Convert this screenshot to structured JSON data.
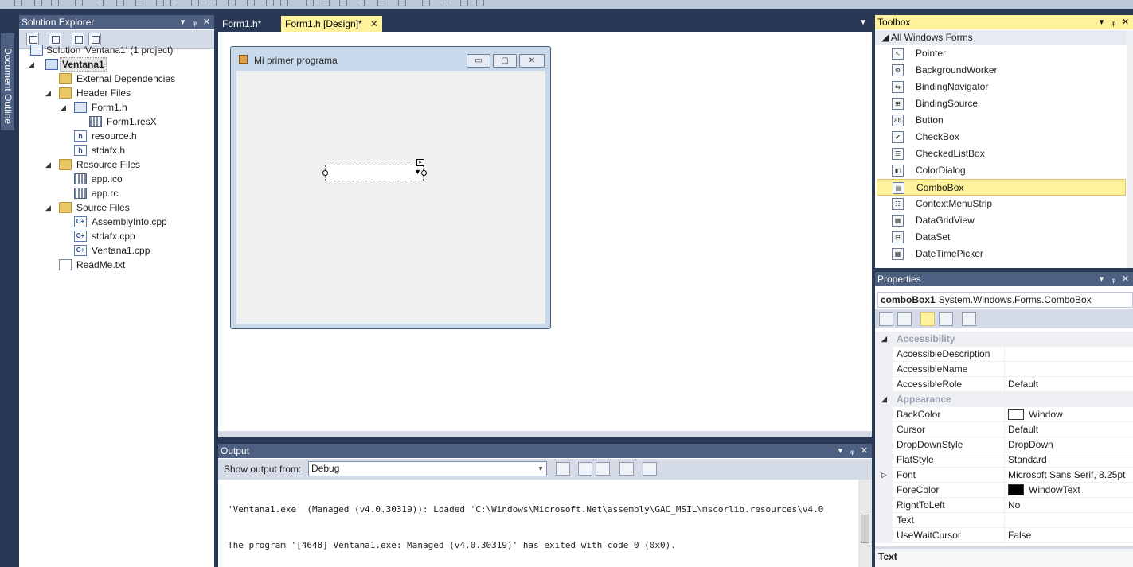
{
  "doc_outline": {
    "label": "Document Outline"
  },
  "solution_explorer": {
    "title": "Solution Explorer",
    "header_buttons": [
      "▾",
      "ᵩ",
      "✕"
    ],
    "tree": [
      {
        "label": "Solution 'Ventana1' (1 project)",
        "icon": "solution-icon",
        "level": 0,
        "arrow": ""
      },
      {
        "label": "Ventana1",
        "icon": "project-icon",
        "level": 0,
        "arrow": "◢",
        "selected": true
      },
      {
        "label": "External Dependencies",
        "icon": "folder-icon",
        "level": 1,
        "arrow": ""
      },
      {
        "label": "Header Files",
        "icon": "folder-icon",
        "level": 1,
        "arrow": "◢"
      },
      {
        "label": "Form1.h",
        "icon": "form-file-icon",
        "level": 2,
        "arrow": "◢"
      },
      {
        "label": "Form1.resX",
        "icon": "resx-file-icon",
        "level": 3,
        "arrow": ""
      },
      {
        "label": "resource.h",
        "icon": "header-file-icon",
        "level": 2,
        "arrow": ""
      },
      {
        "label": "stdafx.h",
        "icon": "header-file-icon",
        "level": 2,
        "arrow": ""
      },
      {
        "label": "Resource Files",
        "icon": "folder-icon",
        "level": 1,
        "arrow": "◢"
      },
      {
        "label": "app.ico",
        "icon": "ico-file-icon",
        "level": 2,
        "arrow": ""
      },
      {
        "label": "app.rc",
        "icon": "rc-file-icon",
        "level": 2,
        "arrow": ""
      },
      {
        "label": "Source Files",
        "icon": "folder-icon",
        "level": 1,
        "arrow": "◢"
      },
      {
        "label": "AssemblyInfo.cpp",
        "icon": "cpp-file-icon",
        "level": 2,
        "arrow": ""
      },
      {
        "label": "stdafx.cpp",
        "icon": "cpp-file-icon",
        "level": 2,
        "arrow": ""
      },
      {
        "label": "Ventana1.cpp",
        "icon": "cpp-file-icon",
        "level": 2,
        "arrow": ""
      },
      {
        "label": "ReadMe.txt",
        "icon": "text-file-icon",
        "level": 1,
        "arrow": ""
      }
    ]
  },
  "editor": {
    "tabs": [
      {
        "label": "Form1.h*",
        "active": false
      },
      {
        "label": "Form1.h [Design]*",
        "active": true
      }
    ],
    "tab_close": "✕",
    "tab_dropdown": "▼",
    "form": {
      "title": "Mi primer programa",
      "minimize": "▭",
      "maximize": "▢",
      "close": "✕",
      "combo_arrow": "▼"
    }
  },
  "output": {
    "title": "Output",
    "show_label": "Show output from:",
    "source": "Debug",
    "lines": [
      "'Ventana1.exe' (Managed (v4.0.30319)): Loaded 'C:\\Windows\\Microsoft.Net\\assembly\\GAC_MSIL\\mscorlib.resources\\v4.0",
      "The program '[4648] Ventana1.exe: Managed (v4.0.30319)' has exited with code 0 (0x0)."
    ]
  },
  "toolbox": {
    "title": "Toolbox",
    "group": "All Windows Forms",
    "items": [
      {
        "label": "Pointer",
        "icon": "pointer-icon",
        "glyph": "↖"
      },
      {
        "label": "BackgroundWorker",
        "icon": "backgroundworker-icon",
        "glyph": "⚙"
      },
      {
        "label": "BindingNavigator",
        "icon": "bindingnavigator-icon",
        "glyph": "⇆"
      },
      {
        "label": "BindingSource",
        "icon": "bindingsource-icon",
        "glyph": "⊞"
      },
      {
        "label": "Button",
        "icon": "button-icon",
        "glyph": "ab"
      },
      {
        "label": "CheckBox",
        "icon": "checkbox-icon",
        "glyph": "✔"
      },
      {
        "label": "CheckedListBox",
        "icon": "checkedlistbox-icon",
        "glyph": "☰"
      },
      {
        "label": "ColorDialog",
        "icon": "colordialog-icon",
        "glyph": "◧"
      },
      {
        "label": "ComboBox",
        "icon": "combobox-icon",
        "glyph": "▤",
        "selected": true
      },
      {
        "label": "ContextMenuStrip",
        "icon": "contextmenustrip-icon",
        "glyph": "☷"
      },
      {
        "label": "DataGridView",
        "icon": "datagridview-icon",
        "glyph": "▦"
      },
      {
        "label": "DataSet",
        "icon": "dataset-icon",
        "glyph": "⊟"
      },
      {
        "label": "DateTimePicker",
        "icon": "datetimepicker-icon",
        "glyph": "▦"
      }
    ]
  },
  "properties": {
    "title": "Properties",
    "object_name": "comboBox1",
    "object_type": "System.Windows.Forms.ComboBox",
    "categories": [
      {
        "name": "Accessibility",
        "rows": [
          {
            "name": "AccessibleDescription",
            "value": ""
          },
          {
            "name": "AccessibleName",
            "value": ""
          },
          {
            "name": "AccessibleRole",
            "value": "Default"
          }
        ]
      },
      {
        "name": "Appearance",
        "rows": [
          {
            "name": "BackColor",
            "value": "Window",
            "swatch": "#ffffff"
          },
          {
            "name": "Cursor",
            "value": "Default"
          },
          {
            "name": "DropDownStyle",
            "value": "DropDown"
          },
          {
            "name": "FlatStyle",
            "value": "Standard"
          },
          {
            "name": "Font",
            "value": "Microsoft Sans Serif, 8.25pt",
            "expandable": true
          },
          {
            "name": "ForeColor",
            "value": "WindowText",
            "swatch": "#000000"
          },
          {
            "name": "RightToLeft",
            "value": "No"
          },
          {
            "name": "Text",
            "value": ""
          },
          {
            "name": "UseWaitCursor",
            "value": "False"
          }
        ]
      }
    ],
    "description_title": "Text"
  },
  "colors": {
    "frame": "#293955",
    "active_header": "#fff29d",
    "inactive_header": "#4d6082"
  }
}
